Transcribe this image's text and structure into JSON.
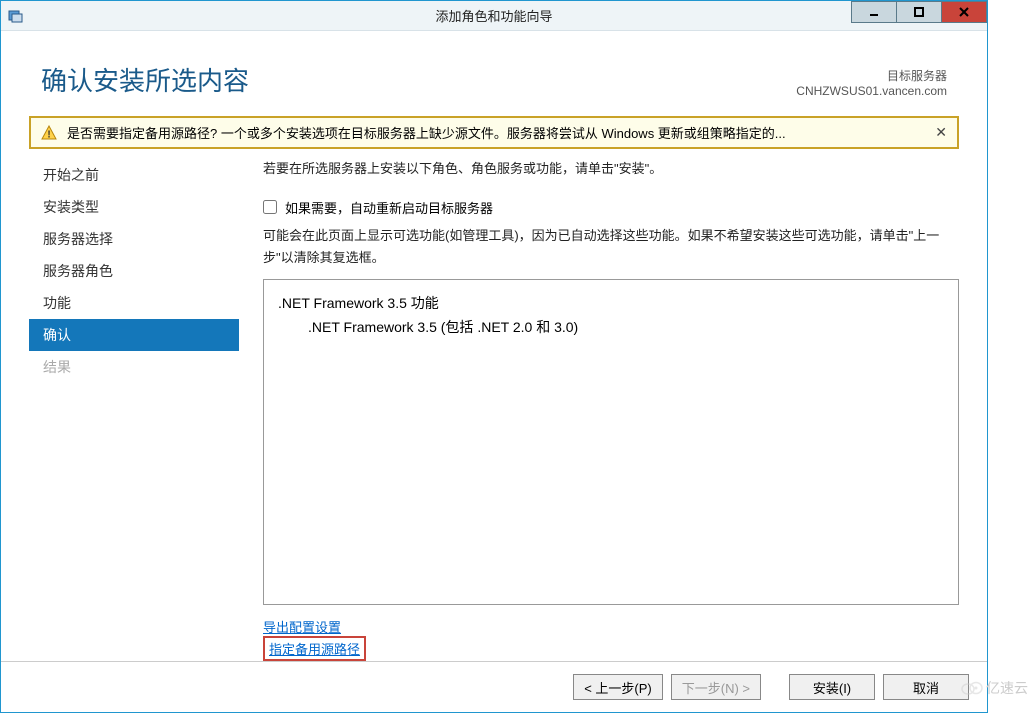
{
  "window": {
    "title": "添加角色和功能向导"
  },
  "header": {
    "page_title": "确认安装所选内容",
    "target_label": "目标服务器",
    "server_name": "CNHZWSUS01.vancen.com"
  },
  "warning": {
    "text": "是否需要指定备用源路径? 一个或多个安装选项在目标服务器上缺少源文件。服务器将尝试从 Windows 更新或组策略指定的..."
  },
  "sidebar": {
    "items": [
      {
        "label": "开始之前",
        "state": "normal"
      },
      {
        "label": "安装类型",
        "state": "normal"
      },
      {
        "label": "服务器选择",
        "state": "normal"
      },
      {
        "label": "服务器角色",
        "state": "normal"
      },
      {
        "label": "功能",
        "state": "normal"
      },
      {
        "label": "确认",
        "state": "active"
      },
      {
        "label": "结果",
        "state": "disabled"
      }
    ]
  },
  "main": {
    "instruction": "若要在所选服务器上安装以下角色、角色服务或功能，请单击\"安装\"。",
    "checkbox_label": "如果需要，自动重新启动目标服务器",
    "description": "可能会在此页面上显示可选功能(如管理工具)，因为已自动选择这些功能。如果不希望安装这些可选功能，请单击\"上一步\"以清除其复选框。",
    "features": {
      "parent": ".NET Framework 3.5 功能",
      "child": ".NET Framework 3.5 (包括 .NET 2.0 和 3.0)"
    },
    "links": {
      "export": "导出配置设置",
      "alt_source": "指定备用源路径"
    }
  },
  "buttons": {
    "prev": "< 上一步(P)",
    "next": "下一步(N) >",
    "install": "安装(I)",
    "cancel": "取消"
  },
  "watermark": "亿速云"
}
